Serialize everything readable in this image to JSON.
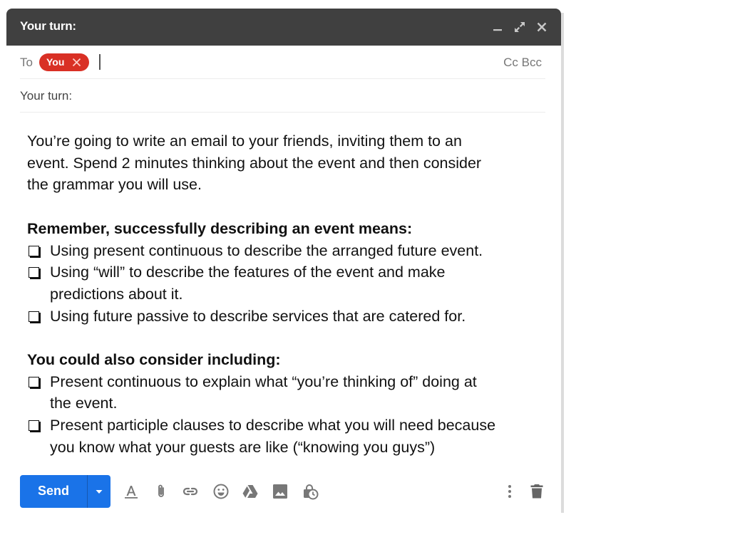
{
  "window": {
    "title": "Your turn:",
    "header_icons": [
      "minimize-icon",
      "expand-icon",
      "close-icon"
    ]
  },
  "compose": {
    "to_label": "To",
    "recipients": [
      {
        "label": "You",
        "chip_color": "#d93025"
      }
    ],
    "cc_bcc_label": "Cc Bcc",
    "subject": "Your turn:"
  },
  "body": {
    "intro": [
      "You’re going to write an email to your friends, inviting them to an",
      "event. Spend 2 minutes thinking about the event and then consider",
      "the grammar you will use."
    ],
    "section1": {
      "heading": "Remember, successfully describing an event means:",
      "items": [
        [
          "Using present continuous to describe the arranged future event."
        ],
        [
          "Using “will” to describe the features of the event and make",
          "predictions about it."
        ],
        [
          "Using future passive to describe services that are catered for."
        ]
      ]
    },
    "section2": {
      "heading": "You could also consider including:",
      "items": [
        [
          "Present continuous to  explain what “you’re thinking of” doing at",
          "the event."
        ],
        [
          "Present participle clauses to describe what you will need because",
          "you know what your guests are like (“knowing you guys”)"
        ]
      ]
    }
  },
  "footer": {
    "send_label": "Send",
    "send_color": "#1a73e8",
    "tools": [
      "format-text-icon",
      "attach-icon",
      "link-icon",
      "emoji-icon",
      "drive-icon",
      "photo-icon",
      "confidential-mode-icon"
    ],
    "more_options": "more-options-icon",
    "discard": "trash-icon"
  }
}
